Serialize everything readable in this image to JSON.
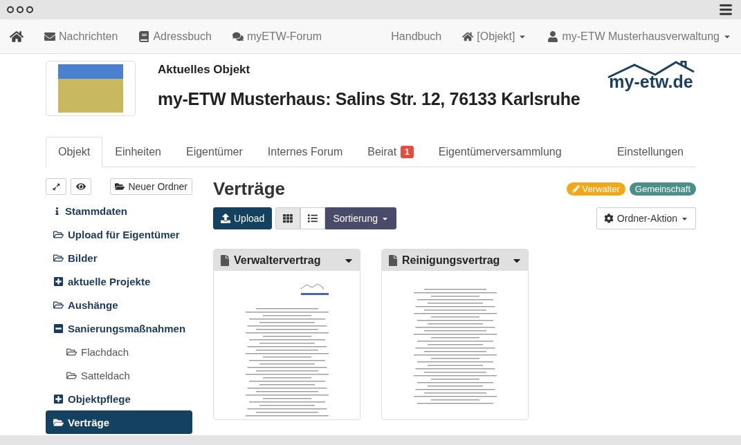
{
  "navbar": {
    "left": [
      {
        "label": "Nachrichten",
        "kind": "messages"
      },
      {
        "label": "Adressbuch",
        "kind": "book"
      },
      {
        "label": "myETW-Forum",
        "kind": "forum"
      }
    ],
    "right": [
      {
        "label": "Handbuch",
        "kind": "plain",
        "dropdown": false
      },
      {
        "label": "[Objekt]",
        "kind": "home",
        "dropdown": true
      },
      {
        "label": "my-ETW Musterhausverwaltung",
        "kind": "user",
        "dropdown": true
      }
    ]
  },
  "header": {
    "subtitle": "Aktuelles Objekt",
    "title": "my-ETW Musterhaus: Salins Str. 12, 76133 Karlsruhe",
    "logo": "my-etw.de"
  },
  "tabs": [
    {
      "label": "Objekt",
      "selected": true
    },
    {
      "label": "Einheiten",
      "selected": false
    },
    {
      "label": "Eigentümer",
      "selected": false
    },
    {
      "label": "Internes Forum",
      "selected": false
    },
    {
      "label": "Beirat",
      "selected": false,
      "badge": "1"
    },
    {
      "label": "Eigentümerversammlung",
      "selected": false
    },
    {
      "label": "Einstellungen",
      "selected": false
    }
  ],
  "sidebar": {
    "new_folder": "Neuer Ordner",
    "items": [
      {
        "label": "Stammdaten",
        "kind": "info",
        "selected": false
      },
      {
        "label": "Upload für Eigentümer",
        "kind": "folder",
        "selected": false
      },
      {
        "label": "Bilder",
        "kind": "folder",
        "selected": false
      },
      {
        "label": "aktuelle Projekte",
        "kind": "collapsed",
        "selected": false
      },
      {
        "label": "Aushänge",
        "kind": "folder",
        "selected": false
      },
      {
        "label": "Sanierungsmaßnahmen",
        "kind": "expanded",
        "selected": false,
        "children": [
          {
            "label": "Flachdach",
            "kind": "folder",
            "selected": false
          },
          {
            "label": "Satteldach",
            "kind": "folder",
            "selected": false
          }
        ]
      },
      {
        "label": "Objektpflege",
        "kind": "collapsed",
        "selected": false
      },
      {
        "label": "Verträge",
        "kind": "folder",
        "selected": true
      }
    ]
  },
  "main": {
    "title": "Verträge",
    "tags": [
      {
        "label": "Verwalter",
        "kind": "edit",
        "color": "#f0a818"
      },
      {
        "label": "Gemeinschaft",
        "kind": "plain",
        "color": "#4a9088"
      }
    ],
    "upload": "Upload",
    "view_modes": [
      {
        "kind": "grid",
        "selected": true
      },
      {
        "kind": "list",
        "selected": false
      }
    ],
    "sort": "Sortierung",
    "action": "Ordner-Aktion",
    "documents": [
      {
        "title": "Verwaltervertrag",
        "kind": "logo"
      },
      {
        "title": "Reinigungsvertrag",
        "kind": "plain"
      }
    ]
  }
}
